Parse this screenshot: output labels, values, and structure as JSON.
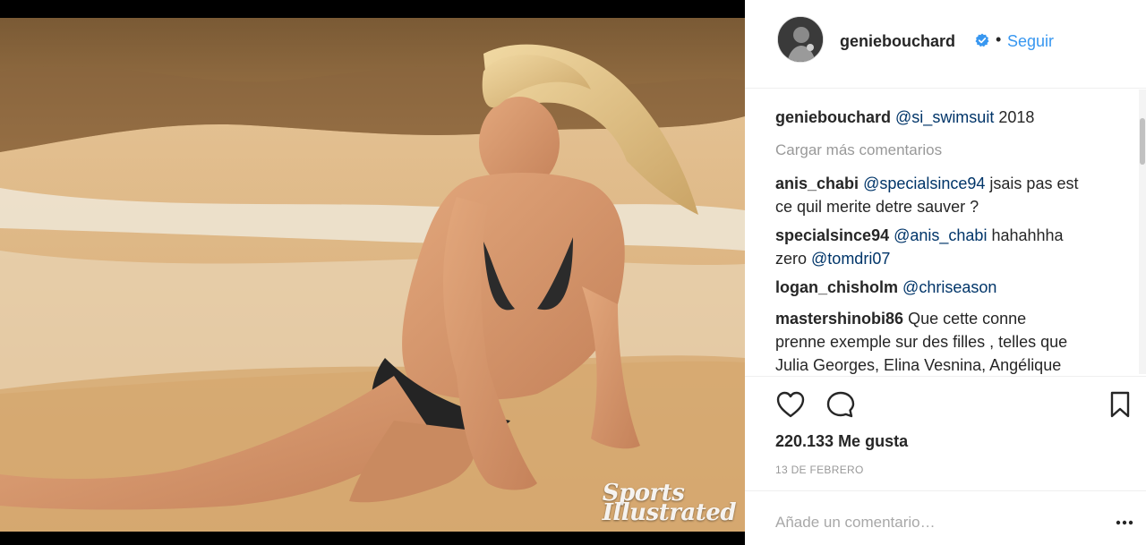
{
  "post": {
    "username": "geniebouchard",
    "follow_label": "Seguir",
    "separator": "•",
    "likes": "220.133 Me gusta",
    "date": "13 DE FEBRERO",
    "add_comment_placeholder": "Añade un comentario…"
  },
  "photo": {
    "watermark_line1": "Sports",
    "watermark_line2": "Illustrated"
  },
  "caption": {
    "user": "geniebouchard",
    "mention": "@si_swimsuit",
    "text": " 2018"
  },
  "load_more_label": "Cargar más comentarios",
  "comments": [
    {
      "user": "anis_chabi",
      "mention": "@specialsince94",
      "text": " jsais pas est",
      "line2": "ce quil merite detre sauver ?"
    },
    {
      "user": "specialsince94",
      "mention": "@anis_chabi",
      "text": " hahahhha",
      "line2a": "zero ",
      "mention2": "@tomdri07"
    },
    {
      "user": "logan_chisholm",
      "mention": "@chriseason"
    },
    {
      "user": "mastershinobi86",
      "text": " Que cette conne",
      "line2": "prenne exemple sur des filles , telles que",
      "line3": "Julia Georges, Elina Vesnina, Angélique"
    }
  ],
  "icons": {
    "like": "heart-icon",
    "comment": "speech-bubble-icon",
    "save": "bookmark-icon",
    "verified": "verified-badge-icon",
    "more": "ellipsis-icon"
  },
  "colors": {
    "link": "#3897f0",
    "mention": "#003569",
    "muted": "#999999"
  }
}
